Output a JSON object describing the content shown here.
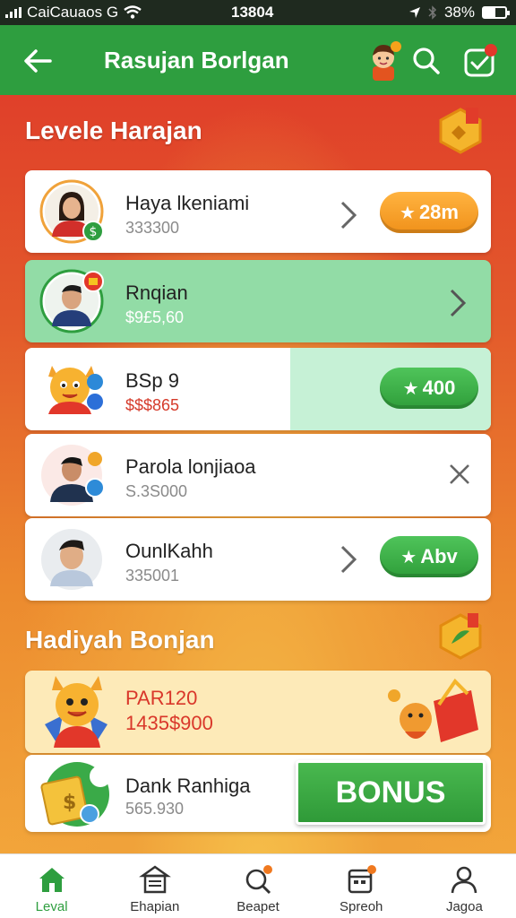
{
  "status": {
    "carrier": "CaiCauaos G",
    "time": "13804",
    "battery": "38%"
  },
  "appbar": {
    "title": "Rasujan Borlgan"
  },
  "sections": {
    "level_title": "Levele Harajan",
    "gift_title": "Hadiyah Bonjan"
  },
  "rows": [
    {
      "name": "Haya lkeniami",
      "amount": "333300",
      "pill": "28m",
      "pill_color": "#f0911a",
      "action": "chevron"
    },
    {
      "name": "Rnqian",
      "amount": "$9£5,60",
      "pill": "",
      "action": "chevron"
    },
    {
      "name": "BSp 9",
      "amount": "$$$865",
      "pill": "400",
      "pill_color": "#2f9e3a",
      "action": "none"
    },
    {
      "name": "Parola lonjiaoa",
      "amount": "S.3S000",
      "pill": "",
      "action": "close"
    },
    {
      "name": "OunlKahh",
      "amount": "335001",
      "pill": "Abv",
      "pill_color": "#2f9e3a",
      "action": "chevron"
    }
  ],
  "reward": {
    "title": "PAR120",
    "amount": "1435$900"
  },
  "bank": {
    "name": "Dank Ranhiga",
    "amount": "565.930",
    "button": "BONUS"
  },
  "tabs": [
    {
      "label": "Leval",
      "icon": "home-icon",
      "active": true
    },
    {
      "label": "Ehapian",
      "icon": "store-icon",
      "active": false
    },
    {
      "label": "Beapet",
      "icon": "search-icon",
      "active": false
    },
    {
      "label": "Spreoh",
      "icon": "calendar-icon",
      "active": false
    },
    {
      "label": "Jagoa",
      "icon": "profile-icon",
      "active": false
    }
  ],
  "colors": {
    "primary_green": "#2e9e3f",
    "accent_orange": "#f0911a",
    "background_red": "#e0402a"
  }
}
